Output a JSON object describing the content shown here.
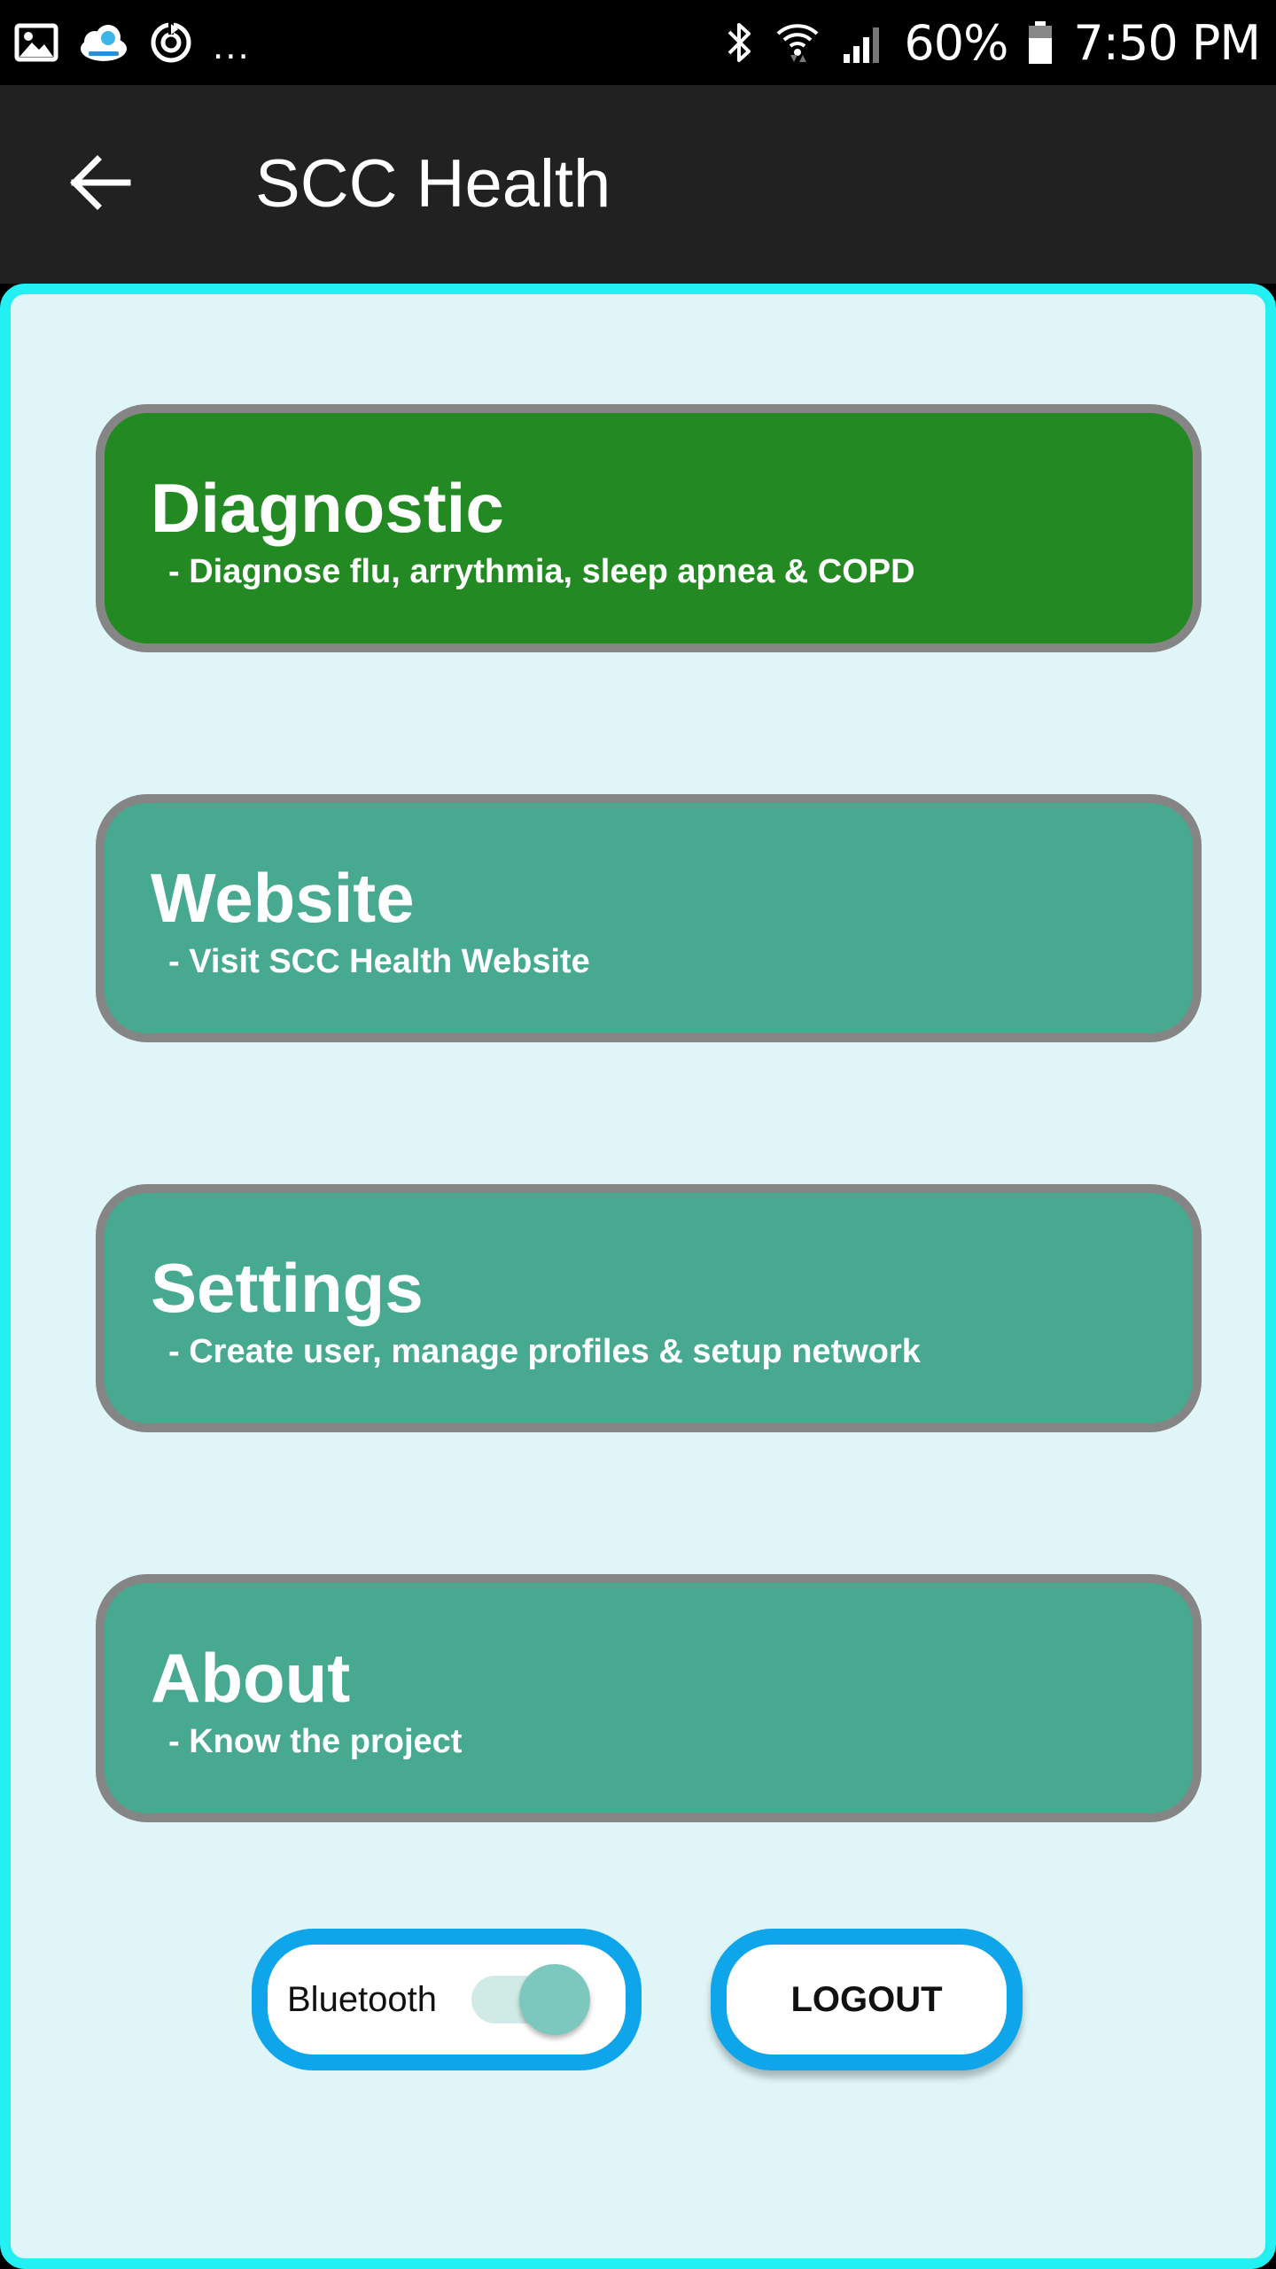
{
  "status_bar": {
    "battery": "60%",
    "time": "7:50 PM",
    "notification_overflow": "...",
    "left_icons": [
      "gallery-icon",
      "scc-health-app-icon",
      "sync-icon"
    ],
    "right_icons": [
      "bluetooth-icon",
      "wifi-icon",
      "signal-icon",
      "battery-icon"
    ]
  },
  "app_bar": {
    "title": "SCC Health",
    "back_icon": "arrow-back-icon"
  },
  "menu": [
    {
      "title": "Diagnostic",
      "subtitle": "- Diagnose flu, arrythmia, sleep apnea & COPD",
      "active": true
    },
    {
      "title": "Website",
      "subtitle": "- Visit SCC Health Website",
      "active": false
    },
    {
      "title": "Settings",
      "subtitle": "- Create user, manage profiles & setup network",
      "active": false
    },
    {
      "title": "About",
      "subtitle": "- Know the project",
      "active": false
    }
  ],
  "controls": {
    "bluetooth_label": "Bluetooth",
    "bluetooth_on": true,
    "logout_label": "LOGOUT"
  },
  "colors": {
    "status_bar": "#000000",
    "app_bar": "#212121",
    "content_background": "#dff5f7",
    "content_border": "#22f0f2",
    "active_card": "#238a23",
    "card": "#48a991",
    "card_border": "#858585",
    "control_border": "#0ea5ea",
    "switch_thumb": "#7cc8bf"
  }
}
